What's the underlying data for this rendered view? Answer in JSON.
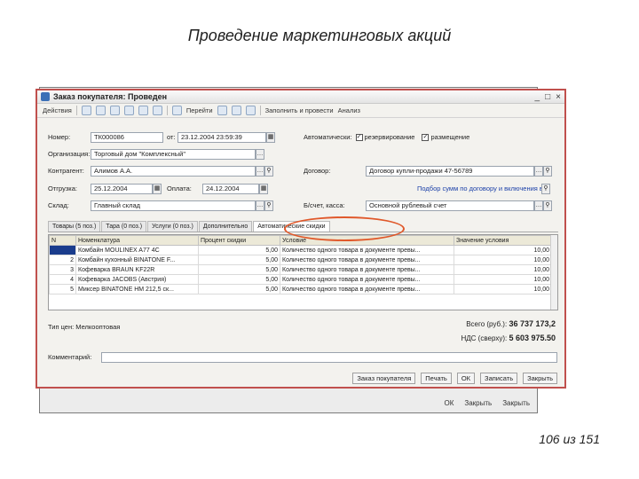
{
  "slide": {
    "title": "Проведение маркетинговых акций",
    "page_counter": "106 из 151"
  },
  "back_window": {
    "buttons": [
      "ОК",
      "Закрыть",
      "Закрыть"
    ]
  },
  "window": {
    "title": "Заказ покупателя: Проведен",
    "toolbar": {
      "items": [
        "Действия",
        "Перейти",
        "Заполнить и провести",
        "Анализ"
      ]
    },
    "fields": {
      "number_label": "Номер:",
      "number_value": "ТК000086",
      "date_label": "от:",
      "date_value": "23.12.2004 23:59:39",
      "auto_label": "Автоматически:",
      "reserve_label": "резервирование",
      "placement_label": "размещение",
      "org_label": "Организация:",
      "org_value": "Торговый дом \"Комплексный\"",
      "contractor_label": "Контрагент:",
      "contractor_value": "Алимов А.А.",
      "contract_label": "Договор:",
      "contract_value": "Договор купли-продажи 47-56789",
      "shipment_label": "Отгрузка:",
      "shipment_value": "25.12.2004",
      "payment_label": "Оплата:",
      "payment_value": "24.12.2004",
      "prices_link": "Подбор сумм по договору и включения в цену",
      "warehouse_label": "Склад:",
      "warehouse_value": "Главный склад",
      "cashbox_label": "Б/счет, касса:",
      "cashbox_value": "Основной рублевый счет"
    },
    "tabs": [
      "Товары (5 поз.)",
      "Тара (0 поз.)",
      "Услуги (0 поз.)",
      "Дополнительно",
      "Автоматические скидки"
    ],
    "table": {
      "columns": [
        "N",
        "Номенклатура",
        "Процент скидки",
        "Условие",
        "Значение условия"
      ],
      "rows": [
        {
          "n": "1",
          "name": "Комбайн MOULINEX A77 4C",
          "pct": "5,00",
          "cond": "Количество одного товара в документе превы...",
          "val": "10,00"
        },
        {
          "n": "2",
          "name": "Комбайн кухонный BINATONE F...",
          "pct": "5,00",
          "cond": "Количество одного товара в документе превы...",
          "val": "10,00"
        },
        {
          "n": "3",
          "name": "Кофеварка BRAUN KF22R",
          "pct": "5,00",
          "cond": "Количество одного товара в документе превы...",
          "val": "10,00"
        },
        {
          "n": "4",
          "name": "Кофеварка JACOBS (Австрия)",
          "pct": "5,00",
          "cond": "Количество одного товара в документе превы...",
          "val": "10,00"
        },
        {
          "n": "5",
          "name": "Миксер BINATONE HM 212,5 ск...",
          "pct": "5,00",
          "cond": "Количество одного товара в документе превы...",
          "val": "10,00"
        }
      ]
    },
    "price_type": "Тип цен: Мелкооптовая",
    "totals": {
      "total_label": "Всего (руб.):",
      "total_value": "36 737 173,2",
      "vat_label": "НДС (сверху):",
      "vat_value": "5 603 975.50"
    },
    "comment_label": "Комментарий:",
    "footer_buttons": [
      "Заказ покупателя",
      "Печать",
      "ОК",
      "Записать",
      "Закрыть"
    ]
  }
}
